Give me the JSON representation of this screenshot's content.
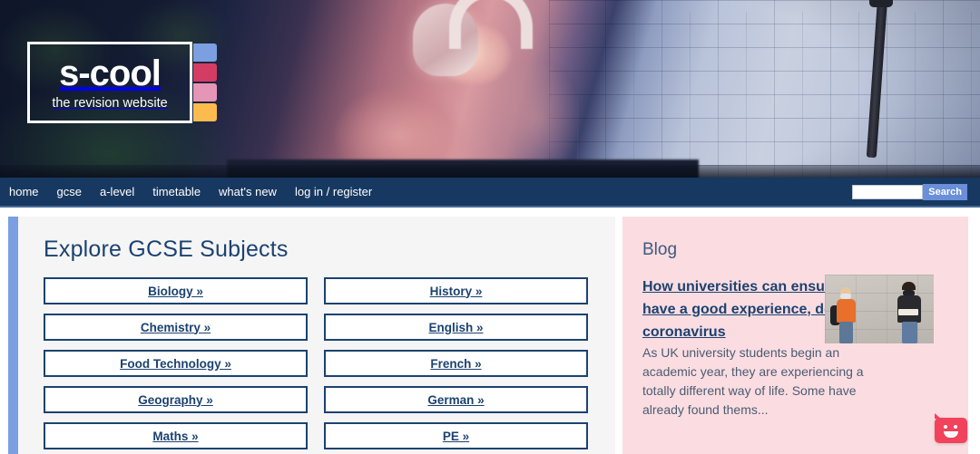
{
  "site": {
    "logo_title": "s-cool",
    "logo_subtitle": "the revision website",
    "logo_tab_colors": [
      "#7b9fe0",
      "#d43d63",
      "#e595b5",
      "#fcbb4f"
    ]
  },
  "hero": {
    "alt": "Smiling student wearing pink headphones studying at a laptop at night in front of a blue-lit white brick wall"
  },
  "nav": {
    "items": [
      {
        "label": "home",
        "name": "nav-link-home"
      },
      {
        "label": "gcse",
        "name": "nav-link-gcse"
      },
      {
        "label": "a-level",
        "name": "nav-link-a-level"
      },
      {
        "label": "timetable",
        "name": "nav-link-timetable"
      },
      {
        "label": "what's new",
        "name": "nav-link-whats-new"
      },
      {
        "label": "log in / register",
        "name": "nav-link-login-register"
      }
    ],
    "search": {
      "value": "",
      "placeholder": "",
      "button_label": "Search"
    },
    "bg_color": "#173860",
    "search_button_color": "#6a8ed8"
  },
  "main": {
    "title": "Explore GCSE Subjects",
    "accent_color": "#7b9fe0",
    "card_bg": "#f5f5f5",
    "subjects": [
      {
        "label": "Biology »"
      },
      {
        "label": "History »"
      },
      {
        "label": "Chemistry »"
      },
      {
        "label": "English »"
      },
      {
        "label": "Food Technology »"
      },
      {
        "label": "French »"
      },
      {
        "label": "Geography »"
      },
      {
        "label": "German »"
      },
      {
        "label": "Maths »"
      },
      {
        "label": "PE »"
      }
    ]
  },
  "blog": {
    "label": "Blog",
    "headline": "How universities can ensure students still have a good experience, despite coronavirus",
    "excerpt": "As UK university students begin an academic year, they are experiencing a totally different way of life. Some have already found thems...",
    "thumbnail_alt": "Two masked students standing apart against a concrete wall",
    "bg_color": "#fbdde1"
  },
  "feedback_widget": {
    "name": "feedback-chat-button",
    "color": "#f1435c"
  }
}
